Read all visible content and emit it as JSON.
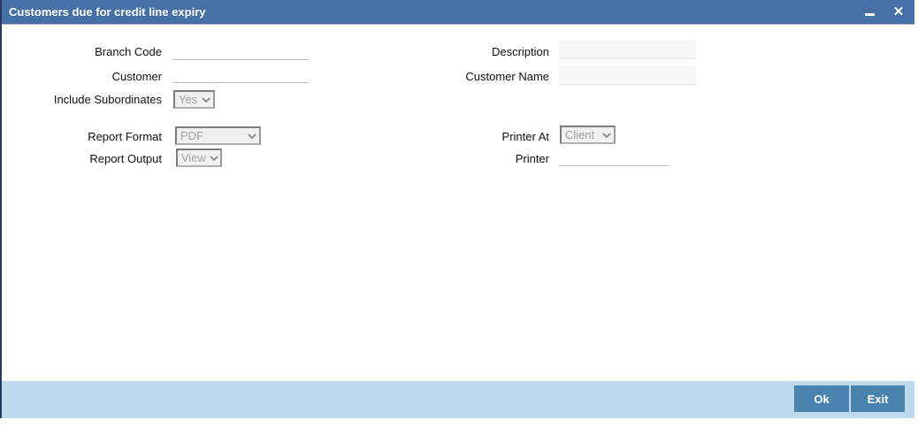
{
  "window": {
    "title": "Customers due for credit line expiry",
    "close_icon": "✕"
  },
  "colors": {
    "titlebar": "#4671a8",
    "window_border": "#27395f",
    "footer_bar": "#bdd9ee",
    "button": "#4884ad",
    "readonly_field": "#f7f7f6"
  },
  "fields": {
    "branch_code": {
      "label": "Branch Code",
      "value": ""
    },
    "customer": {
      "label": "Customer",
      "value": ""
    },
    "include_subordinates": {
      "label": "Include Subordinates",
      "value": "Yes"
    },
    "report_format": {
      "label": "Report Format",
      "value": "PDF"
    },
    "report_output": {
      "label": "Report Output",
      "value": "View"
    },
    "description": {
      "label": "Description",
      "value": ""
    },
    "customer_name": {
      "label": "Customer Name",
      "value": ""
    },
    "printer_at": {
      "label": "Printer At",
      "value": "Client"
    },
    "printer": {
      "label": "Printer",
      "value": ""
    }
  },
  "footer": {
    "ok_label": "Ok",
    "exit_label": "Exit"
  }
}
